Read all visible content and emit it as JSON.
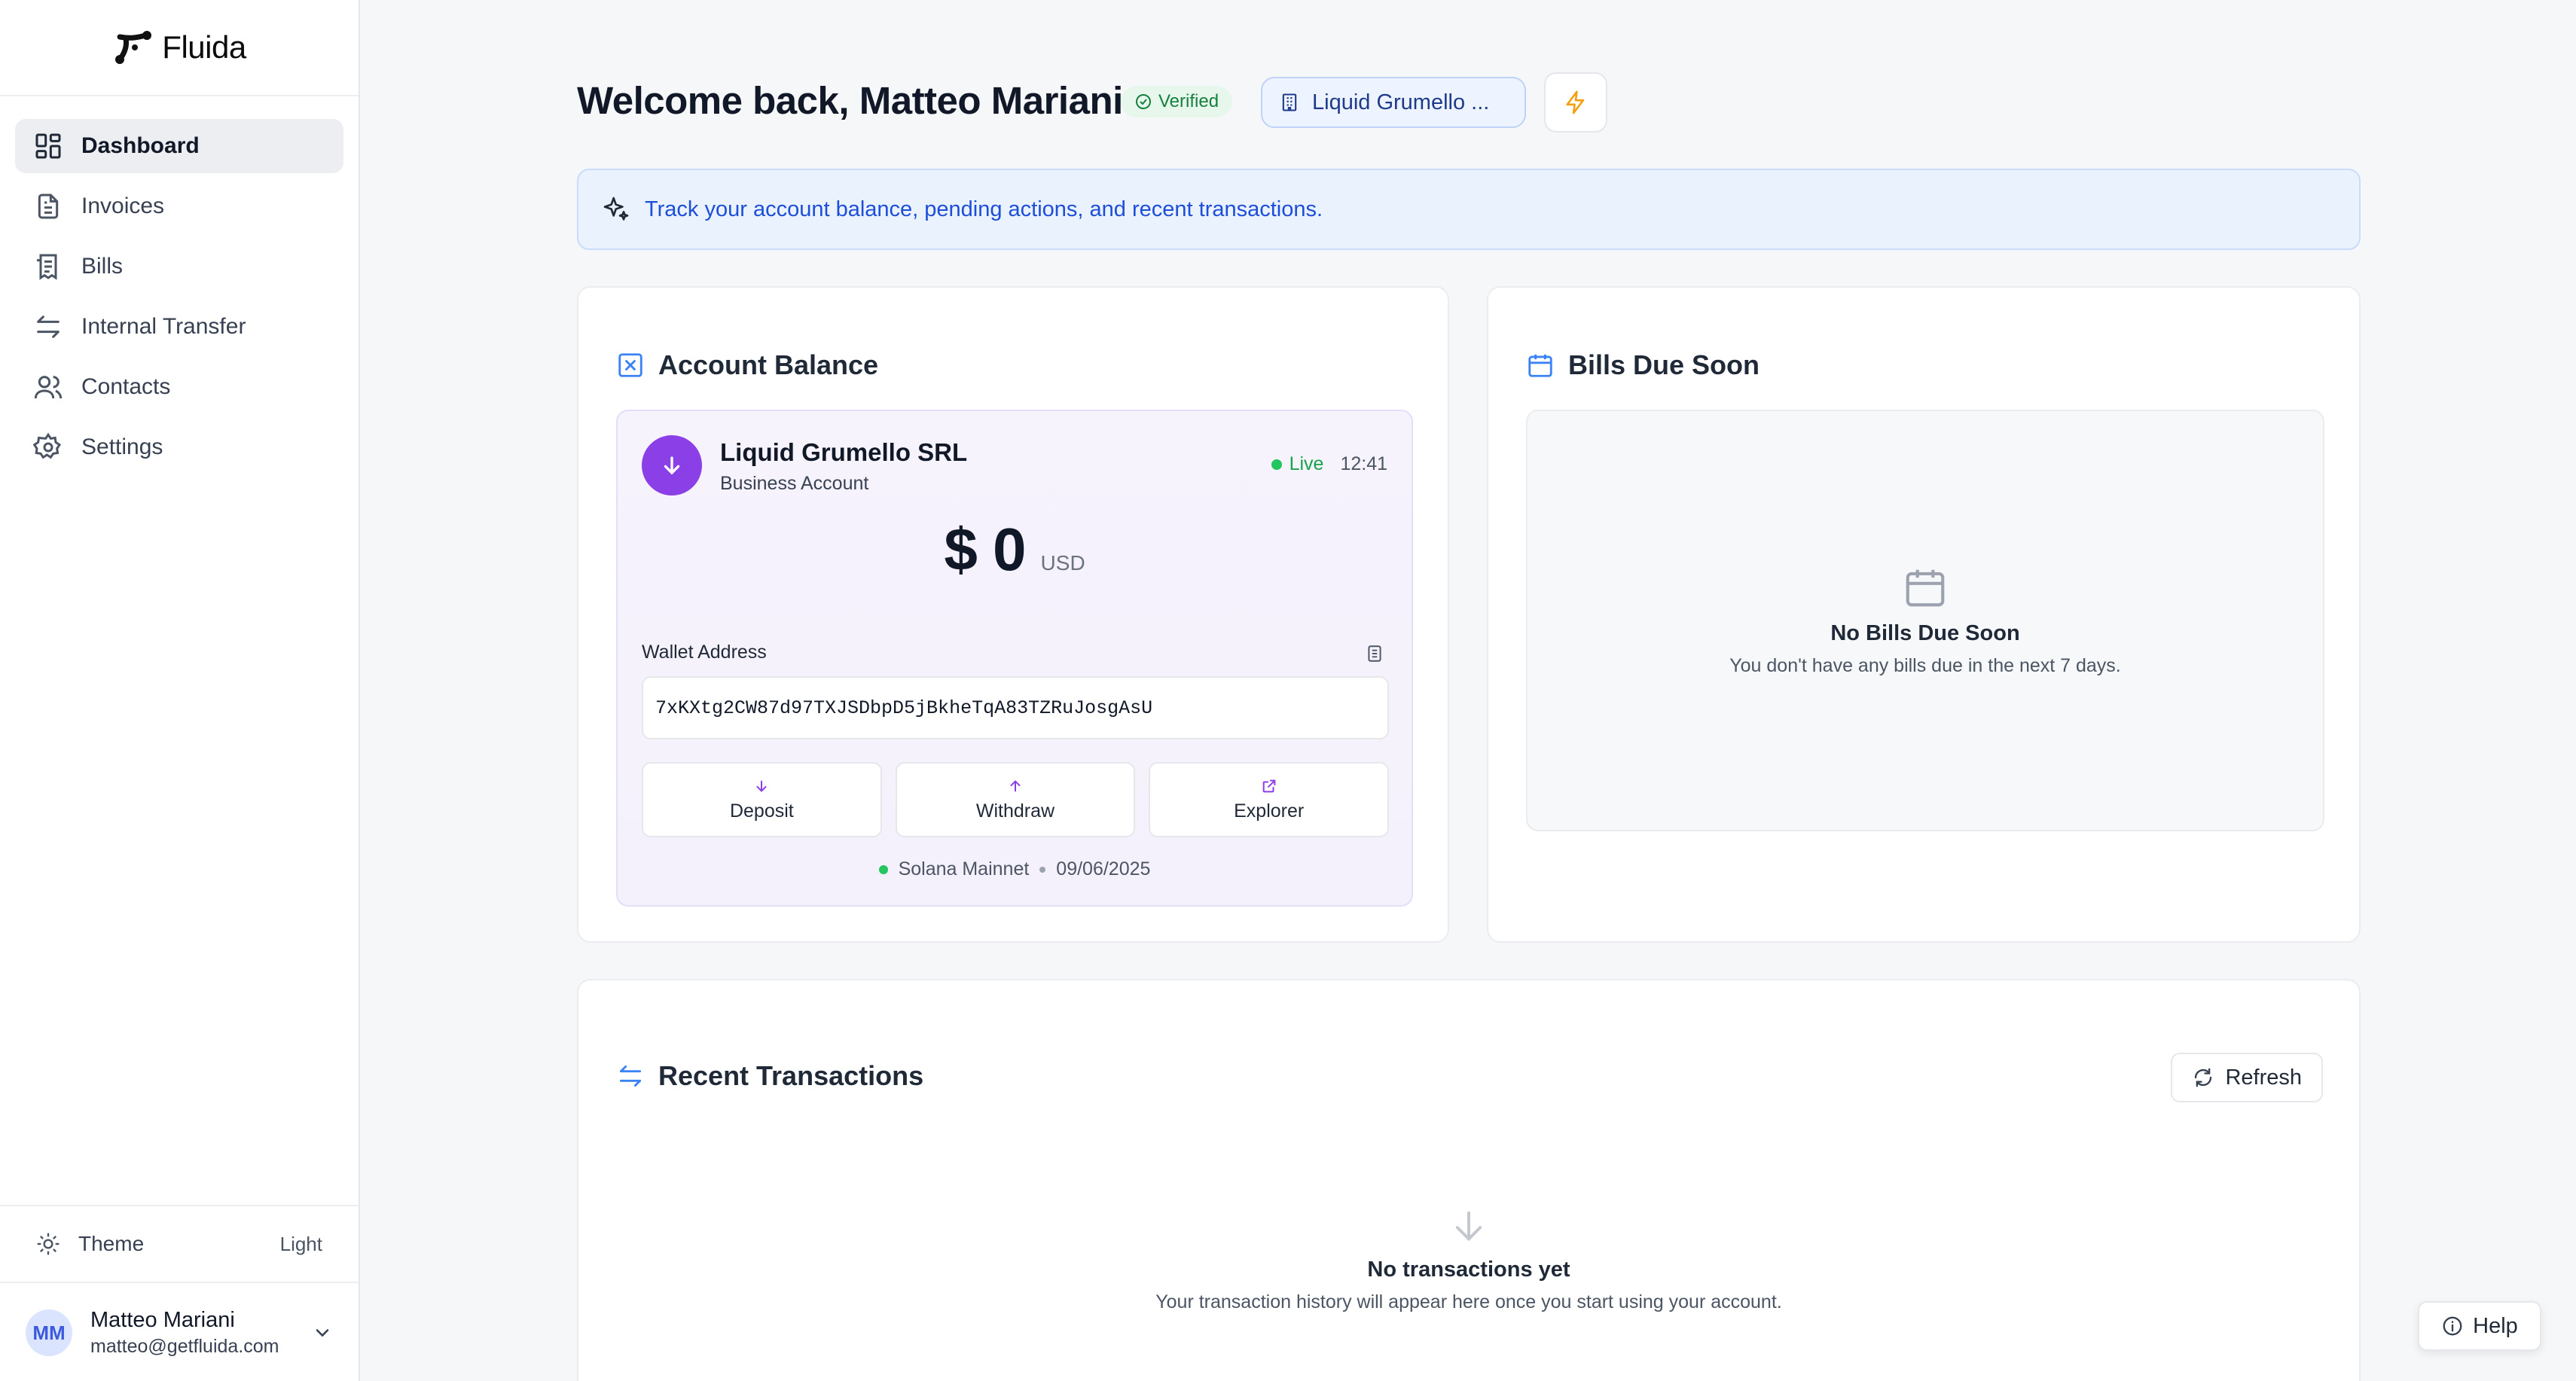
{
  "app": {
    "name": "Fluida"
  },
  "sidebar": {
    "items": [
      {
        "label": "Dashboard",
        "icon": "dashboard-icon",
        "active": true
      },
      {
        "label": "Invoices",
        "icon": "invoice-icon",
        "active": false
      },
      {
        "label": "Bills",
        "icon": "bills-icon",
        "active": false
      },
      {
        "label": "Internal Transfer",
        "icon": "transfer-icon",
        "active": false
      },
      {
        "label": "Contacts",
        "icon": "contacts-icon",
        "active": false
      },
      {
        "label": "Settings",
        "icon": "gear-icon",
        "active": false
      }
    ],
    "theme": {
      "label": "Theme",
      "value": "Light"
    },
    "user": {
      "initials": "MM",
      "name": "Matteo Mariani",
      "email": "matteo@getfluida.com"
    }
  },
  "header": {
    "title": "Welcome back, Matteo Mariani",
    "verified_label": "Verified",
    "account_label": "Liquid Grumello ..."
  },
  "banner": {
    "text": "Track your account balance, pending actions, and recent transactions."
  },
  "balance_card": {
    "title": "Account Balance",
    "company": "Liquid Grumello SRL",
    "account_type": "Business Account",
    "status": "Live",
    "time": "12:41",
    "amount": "$ 0",
    "currency": "USD",
    "wallet_label": "Wallet Address",
    "wallet_address": "7xKXtg2CW87d97TXJSDbpD5jBkheTqA83TZRuJosgAsU",
    "actions": {
      "deposit": "Deposit",
      "withdraw": "Withdraw",
      "explorer": "Explorer"
    },
    "network": "Solana Mainnet",
    "date": "09/06/2025"
  },
  "bills_card": {
    "title": "Bills Due Soon",
    "empty_title": "No Bills Due Soon",
    "empty_sub": "You don't have any bills due in the next 7 days."
  },
  "transactions": {
    "title": "Recent Transactions",
    "refresh_label": "Refresh",
    "empty_title": "No transactions yet",
    "empty_sub": "Your transaction history will appear here once you start using your account."
  },
  "help": {
    "label": "Help"
  },
  "colors": {
    "accent_purple": "#8b3fe6",
    "brand_blue": "#2563eb",
    "success": "#16a34a"
  }
}
